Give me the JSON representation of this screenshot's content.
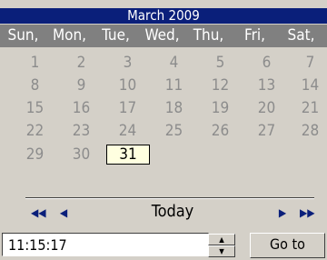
{
  "calendar": {
    "month_title": "March 2009",
    "weekdays": [
      "Sun,",
      "Mon,",
      "Tue,",
      "Wed,",
      "Thu,",
      "Fri,",
      "Sat,"
    ],
    "weeks": [
      [
        "1",
        "2",
        "3",
        "4",
        "5",
        "6",
        "7"
      ],
      [
        "8",
        "9",
        "10",
        "11",
        "12",
        "13",
        "14"
      ],
      [
        "15",
        "16",
        "17",
        "18",
        "19",
        "20",
        "21"
      ],
      [
        "22",
        "23",
        "24",
        "25",
        "26",
        "27",
        "28"
      ],
      [
        "29",
        "30",
        "31",
        "",
        "",
        "",
        ""
      ]
    ],
    "selected_day": "31",
    "nav": {
      "prev_year_icon": "double-left-arrow",
      "prev_month_icon": "left-arrow",
      "today_label": "Today",
      "next_month_icon": "right-arrow",
      "next_year_icon": "double-right-arrow"
    }
  },
  "time": {
    "value": "11:15:17",
    "spin_up_icon": "spin-up-arrow",
    "spin_down_icon": "spin-down-arrow"
  },
  "goto": {
    "label": "Go to"
  },
  "colors": {
    "header_bg": "#0a1f7a",
    "weekday_bg": "#808080",
    "panel_bg": "#d4d0c8",
    "day_text": "#8c8c8c",
    "selected_bg": "#ffffe0"
  }
}
